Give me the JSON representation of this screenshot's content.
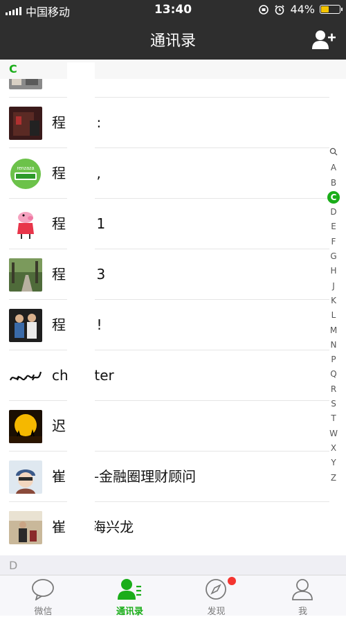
{
  "status_bar": {
    "carrier": "中国移动",
    "time": "13:40",
    "battery": "44%",
    "battery_level": 0.44
  },
  "nav": {
    "title": "通讯录",
    "add_icon": "add-contact-icon"
  },
  "sections": {
    "current": "C",
    "next": "D"
  },
  "contacts": [
    {
      "name": "程",
      "suffix": ":",
      "avatar": "dark-red-photo"
    },
    {
      "name": "程",
      "suffix": ",",
      "avatar": "green-badge-logo"
    },
    {
      "name": "程",
      "suffix": "1",
      "avatar": "peppa-pig"
    },
    {
      "name": "程",
      "suffix": "3",
      "avatar": "forest-path-photo"
    },
    {
      "name": "程",
      "suffix": "!",
      "avatar": "two-people-photo"
    },
    {
      "name": "ch",
      "suffix": "oter",
      "avatar": "calligraphy"
    },
    {
      "name": "迟",
      "suffix": "",
      "avatar": "sunset-silhouette"
    },
    {
      "name": "崔",
      "suffix": "–金融圈理财顾问",
      "avatar": "cartoon-avatar"
    },
    {
      "name": "崔",
      "suffix": "海兴龙",
      "avatar": "speaker-photo"
    }
  ],
  "index_letters": [
    "Q",
    "A",
    "B",
    "C",
    "D",
    "E",
    "F",
    "G",
    "H",
    "J",
    "K",
    "L",
    "M",
    "N",
    "P",
    "Q",
    "R",
    "S",
    "T",
    "W",
    "X",
    "Y",
    "Z"
  ],
  "index_active": "C",
  "tabs": [
    {
      "label": "微信",
      "icon": "chat-bubble-icon"
    },
    {
      "label": "通讯录",
      "icon": "contacts-icon",
      "active": true
    },
    {
      "label": "发现",
      "icon": "compass-icon",
      "badge": true
    },
    {
      "label": "我",
      "icon": "person-icon"
    }
  ],
  "colors": {
    "accent": "#1aad19",
    "header_bg": "#2e2e2e",
    "badge": "#f43530",
    "battery": "#f5c400"
  }
}
